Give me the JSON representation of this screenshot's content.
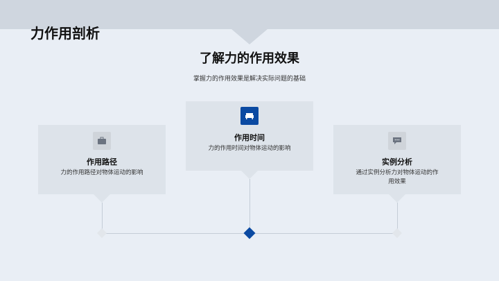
{
  "slide": {
    "title": "力作用剖析",
    "heading": "了解力的作用效果",
    "subheading": "掌握力的作用效果是解决实际问题的基础"
  },
  "cards": [
    {
      "title": "作用路径",
      "desc": "力的作用路径对物体运动的影响",
      "icon": "briefcase-icon"
    },
    {
      "title": "作用时间",
      "desc": "力的作用时间对物体运动的影响",
      "icon": "sofa-icon"
    },
    {
      "title": "实例分析",
      "desc": "通过实例分析力对物体运动的作用效果",
      "icon": "chat-icon"
    }
  ],
  "colors": {
    "accent": "#0b4aa2",
    "card_bg": "#dde3ea",
    "page_bg": "#e9eef5",
    "topbar": "#cfd6df"
  }
}
